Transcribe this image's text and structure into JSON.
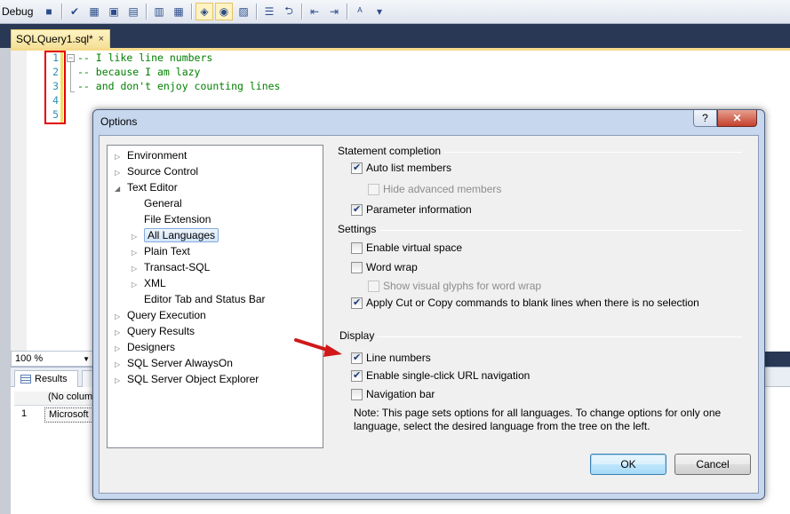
{
  "toolbar": {
    "config_label": "Debug"
  },
  "editor": {
    "tab_label": "SQLQuery1.sql*",
    "tab_close": "×",
    "line_numbers": [
      "1",
      "2",
      "3",
      "4",
      "5"
    ],
    "code_lines": [
      "-- I like line numbers",
      "-- because I am lazy",
      "-- and don't enjoy counting lines"
    ]
  },
  "bottom": {
    "zoom_value": "100 %",
    "results_tab": "Results",
    "grid_header": "(No column name)",
    "grid_row_number": "1",
    "grid_cell": "Microsoft"
  },
  "dialog": {
    "title": "Options",
    "help_label": "?",
    "close_label": "✕",
    "tree": [
      {
        "label": "Environment",
        "arrow": "▷",
        "indent": 0
      },
      {
        "label": "Source Control",
        "arrow": "▷",
        "indent": 0
      },
      {
        "label": "Text Editor",
        "arrow": "◢",
        "indent": 0
      },
      {
        "label": "General",
        "arrow": "",
        "indent": 1
      },
      {
        "label": "File Extension",
        "arrow": "",
        "indent": 1
      },
      {
        "label": "All Languages",
        "arrow": "▷",
        "indent": 1,
        "selected": true
      },
      {
        "label": "Plain Text",
        "arrow": "▷",
        "indent": 1
      },
      {
        "label": "Transact-SQL",
        "arrow": "▷",
        "indent": 1
      },
      {
        "label": "XML",
        "arrow": "▷",
        "indent": 1
      },
      {
        "label": "Editor Tab and Status Bar",
        "arrow": "",
        "indent": 1
      },
      {
        "label": "Query Execution",
        "arrow": "▷",
        "indent": 0
      },
      {
        "label": "Query Results",
        "arrow": "▷",
        "indent": 0
      },
      {
        "label": "Designers",
        "arrow": "▷",
        "indent": 0
      },
      {
        "label": "SQL Server AlwaysOn",
        "arrow": "▷",
        "indent": 0
      },
      {
        "label": "SQL Server Object Explorer",
        "arrow": "▷",
        "indent": 0
      }
    ],
    "statement_completion": {
      "title": "Statement completion",
      "auto_list_members": "Auto list members",
      "hide_advanced_members": "Hide advanced members",
      "parameter_information": "Parameter information"
    },
    "settings": {
      "title": "Settings",
      "enable_virtual_space": "Enable virtual space",
      "word_wrap": "Word wrap",
      "show_visual_glyphs": "Show visual glyphs for word wrap",
      "apply_cut_copy": "Apply Cut or Copy commands to blank lines when there is no selection"
    },
    "display": {
      "title": "Display",
      "line_numbers": "Line numbers",
      "single_click_url": "Enable single-click URL navigation",
      "navigation_bar": "Navigation bar",
      "note_line1": "Note: This page sets options for all languages. To change options for only one",
      "note_line2": "language, select the desired language from the tree on the left."
    },
    "ok_label": "OK",
    "cancel_label": "Cancel"
  },
  "colors": {
    "annotation_red": "#e30000",
    "code_green": "#008000",
    "line_number_teal": "#2b91af"
  }
}
